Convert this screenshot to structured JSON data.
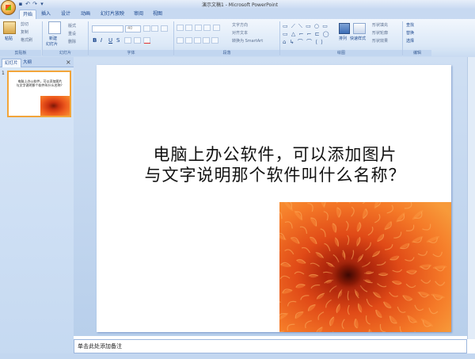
{
  "window": {
    "title": "演示文稿1 - Microsoft PowerPoint",
    "quick_access": [
      "save-icon",
      "undo-icon",
      "redo-icon",
      "dropdown-icon"
    ]
  },
  "tabs": [
    "开始",
    "插入",
    "设计",
    "动画",
    "幻灯片放映",
    "审阅",
    "视图"
  ],
  "active_tab": "开始",
  "ribbon": {
    "clipboard": {
      "paste": "粘贴",
      "cut": "剪切",
      "copy": "复制",
      "format_painter": "格式刷",
      "label": "剪贴板"
    },
    "slides": {
      "new_slide": "新建",
      "new_slide_line2": "幻灯片",
      "layout": "版式",
      "reset": "重设",
      "delete": "删除",
      "label": "幻灯片"
    },
    "font": {
      "size": "40",
      "label": "字体",
      "bold": "B",
      "italic": "I",
      "underline": "U",
      "strike": "S"
    },
    "paragraph": {
      "text_direction": "文字方向",
      "align_text": "对齐文本",
      "smartart": "转换为 SmartArt",
      "label": "段落"
    },
    "drawing": {
      "arrange": "排列",
      "quick_styles": "快速样式",
      "shape_fill": "形状填充",
      "shape_outline": "形状轮廓",
      "shape_effects": "形状效果",
      "label": "绘图"
    },
    "editing": {
      "find": "查找",
      "replace": "替换",
      "select": "选择",
      "label": "编辑"
    }
  },
  "left_pane": {
    "tabs": [
      "幻灯片",
      "大纲"
    ],
    "close": "×",
    "slide_number": "1"
  },
  "slide": {
    "title_line1": "电脑上办公软件，可以添加图片",
    "title_line2": "与文字说明那个软件叫什么名称？"
  },
  "notes": {
    "placeholder": "单击此处添加备注"
  },
  "colors": {
    "accent": "#f2a53a",
    "ribbon": "#dbe8f7",
    "flower": "#e2581a"
  }
}
